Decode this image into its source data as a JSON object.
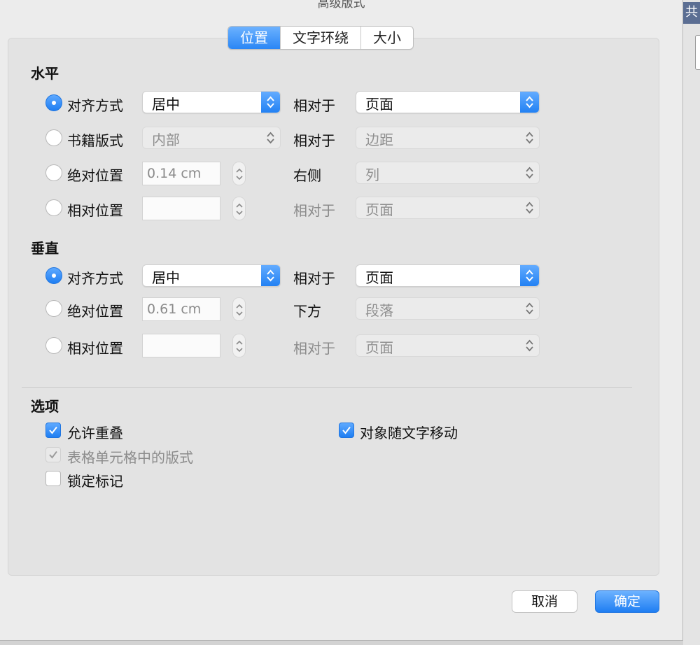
{
  "dialog": {
    "title": "高级版式"
  },
  "tabs": [
    {
      "label": "位置",
      "active": true
    },
    {
      "label": "文字环绕",
      "active": false
    },
    {
      "label": "大小",
      "active": false
    }
  ],
  "horizontal": {
    "title": "水平",
    "rows": [
      {
        "option": "对齐方式",
        "selected": true,
        "value": "居中",
        "relation": "相对于",
        "target": "页面"
      },
      {
        "option": "书籍版式",
        "selected": false,
        "value": "内部",
        "relation": "相对于",
        "target": "边距"
      },
      {
        "option": "绝对位置",
        "selected": false,
        "value": "0.14 cm",
        "relation": "右侧",
        "target": "列"
      },
      {
        "option": "相对位置",
        "selected": false,
        "value": "",
        "relation": "相对于",
        "target": "页面"
      }
    ]
  },
  "vertical": {
    "title": "垂直",
    "rows": [
      {
        "option": "对齐方式",
        "selected": true,
        "value": "居中",
        "relation": "相对于",
        "target": "页面"
      },
      {
        "option": "绝对位置",
        "selected": false,
        "value": "0.61 cm",
        "relation": "下方",
        "target": "段落"
      },
      {
        "option": "相对位置",
        "selected": false,
        "value": "",
        "relation": "相对于",
        "target": "页面"
      }
    ]
  },
  "options": {
    "title": "选项",
    "allow_overlap": {
      "label": "允许重叠",
      "checked": true
    },
    "move_with_text": {
      "label": "对象随文字移动",
      "checked": true
    },
    "layout_in_cell": {
      "label": "表格单元格中的版式",
      "checked": true,
      "disabled": true
    },
    "lock_anchor": {
      "label": "锁定标记",
      "checked": false
    }
  },
  "buttons": {
    "cancel": "取消",
    "ok": "确定"
  },
  "background": {
    "title_fragment": "共"
  },
  "colors": {
    "accent": "#2a86f5",
    "dialog_bg": "#ececec",
    "panel_bg": "#e3e3e3"
  }
}
